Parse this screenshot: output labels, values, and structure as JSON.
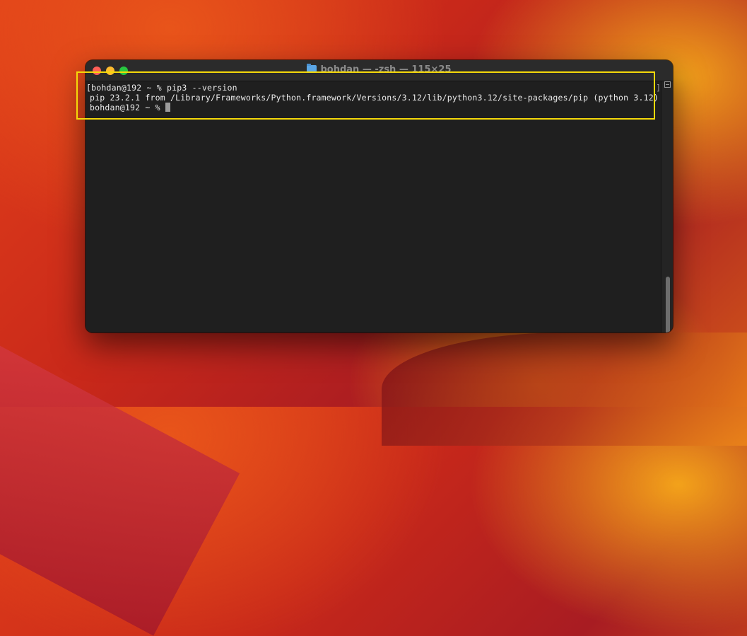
{
  "window": {
    "title": "bohdan — -zsh — 115×25",
    "folder_icon": "folder-icon",
    "close_color": "#ff5f57",
    "minimize_color": "#febc2e",
    "zoom_color": "#28c840"
  },
  "terminal": {
    "lines": [
      "[bohdan@192 ~ % pip3 --version",
      "pip 23.2.1 from /Library/Frameworks/Python.framework/Versions/3.12/lib/python3.12/site-packages/pip (python 3.12)",
      "bohdan@192 ~ % "
    ],
    "right_bracket": "]",
    "background": "#1f1f1f",
    "text_color": "#ececec"
  },
  "annotation": {
    "highlight_color": "#f5d90a"
  }
}
